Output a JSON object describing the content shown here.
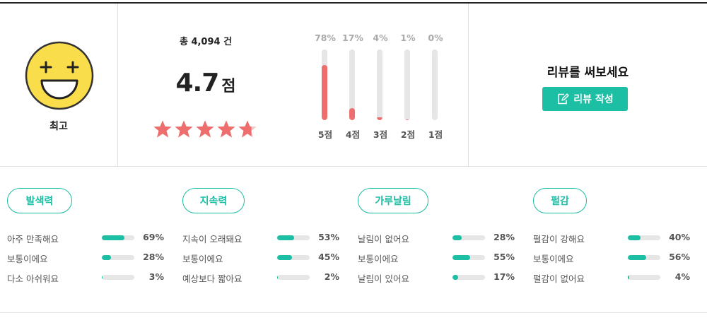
{
  "summary": {
    "grade_label": "최고",
    "grade_icon": "laughing-face-icon",
    "total_count": "총 4,094 건",
    "average": "4.7",
    "average_unit": "점",
    "stars": {
      "rating": 4.7,
      "max": 5,
      "color": "#ee6d6d"
    },
    "distribution": [
      {
        "label": "5점",
        "percent_text": "78%",
        "percent": 78
      },
      {
        "label": "4점",
        "percent_text": "17%",
        "percent": 17
      },
      {
        "label": "3점",
        "percent_text": "4%",
        "percent": 4
      },
      {
        "label": "2점",
        "percent_text": "1%",
        "percent": 1
      },
      {
        "label": "1점",
        "percent_text": "0%",
        "percent": 0
      }
    ],
    "write_prompt": "리뷰를 써보세요",
    "write_button_label": "리뷰 작성",
    "write_button_icon": "pencil-edit-icon"
  },
  "colors": {
    "accent": "#1cbfa4",
    "rating": "#ee6d6d",
    "track": "#e6e6e6"
  },
  "attributes": [
    {
      "title": "발색력",
      "options": [
        {
          "label": "아주 만족해요",
          "percent_text": "69%",
          "percent": 69
        },
        {
          "label": "보통이에요",
          "percent_text": "28%",
          "percent": 28
        },
        {
          "label": "다소 아쉬워요",
          "percent_text": "3%",
          "percent": 3
        }
      ]
    },
    {
      "title": "지속력",
      "options": [
        {
          "label": "지속이 오래돼요",
          "percent_text": "53%",
          "percent": 53
        },
        {
          "label": "보통이에요",
          "percent_text": "45%",
          "percent": 45
        },
        {
          "label": "예상보다 짧아요",
          "percent_text": "2%",
          "percent": 2
        }
      ]
    },
    {
      "title": "가루날림",
      "options": [
        {
          "label": "날림이 없어요",
          "percent_text": "28%",
          "percent": 28
        },
        {
          "label": "보통이에요",
          "percent_text": "55%",
          "percent": 55
        },
        {
          "label": "날림이 있어요",
          "percent_text": "17%",
          "percent": 17
        }
      ]
    },
    {
      "title": "펄감",
      "options": [
        {
          "label": "펄감이 강해요",
          "percent_text": "40%",
          "percent": 40
        },
        {
          "label": "보통이에요",
          "percent_text": "56%",
          "percent": 56
        },
        {
          "label": "펄감이 없어요",
          "percent_text": "4%",
          "percent": 4
        }
      ]
    }
  ]
}
